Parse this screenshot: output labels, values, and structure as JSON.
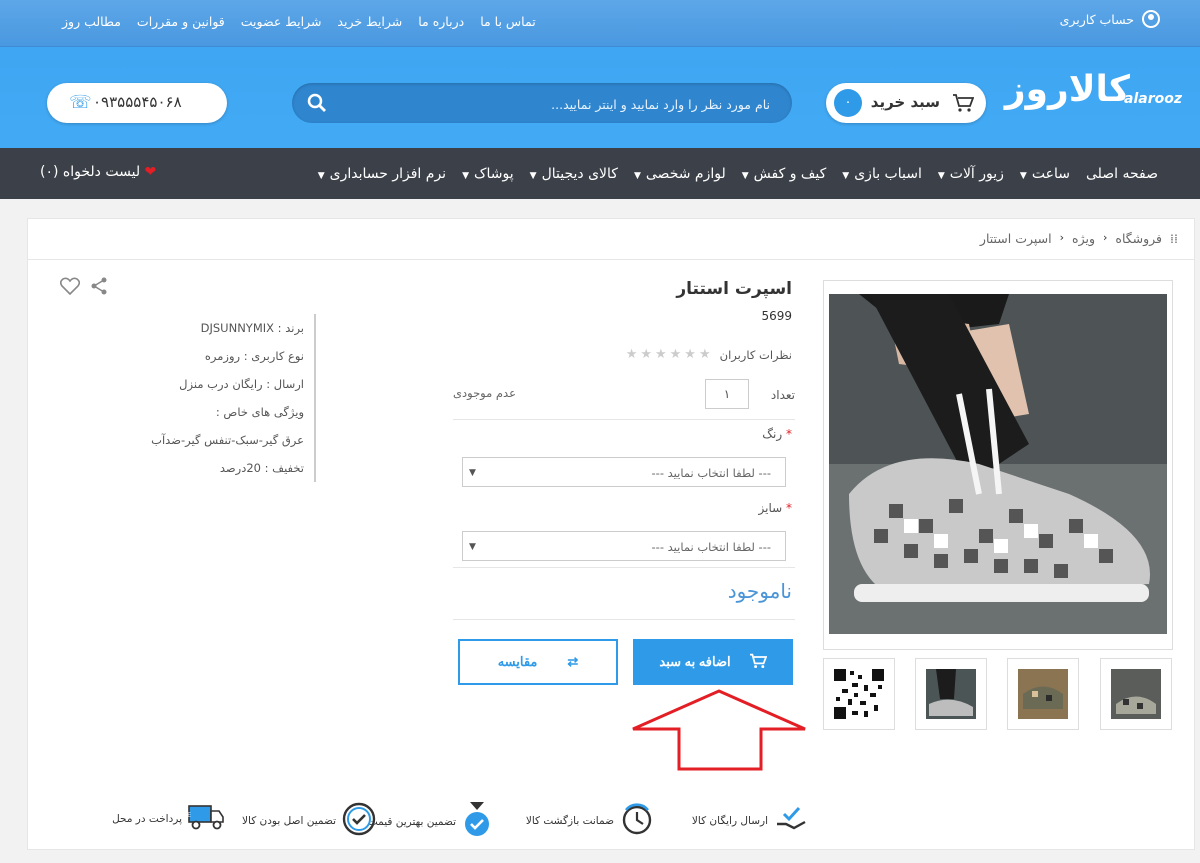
{
  "topbar": {
    "links": [
      "تماس با ما",
      "درباره ما",
      "شرایط خرید",
      "شرایط عضویت",
      "قوانین و مقررات",
      "مطالب روز"
    ],
    "account_label": "حساب کاربری"
  },
  "header": {
    "logo_mark": "کالاروز",
    "logo_latin": "alarooz",
    "cart_label": "سبد خرید",
    "cart_count": "۰",
    "search_placeholder": "نام مورد نظر را وارد نمایید و اینتر نمایید...",
    "phone": "۰۹۳۵۵۵۴۵۰۶۸"
  },
  "nav": {
    "items": [
      "صفحه اصلی",
      "ساعت",
      "زیور آلات",
      "اسباب بازی",
      "کیف و کفش",
      "لوازم شخصی",
      "کالای دیجیتال",
      "پوشاک",
      "نرم افزار حسابداری"
    ],
    "wishlist": "لیست دلخواه (۰)"
  },
  "breadcrumb": [
    "فروشگاه",
    "ویژه",
    "اسپرت استتار"
  ],
  "product": {
    "title": "اسپرت استتار",
    "code": "5699",
    "reviews_label": "نظرات کاربران",
    "qty_label": "تعداد",
    "qty_value": "۱",
    "stock_status": "عدم موجودی",
    "color_label": "رنگ",
    "size_label": "سایز",
    "select_placeholder": "--- لطفا انتخاب نمایید ---",
    "availability": "ناموجود",
    "add_to_cart": "اضافه به سبد",
    "compare": "مقایسه"
  },
  "specs": [
    "برند : DJSUNNYMIX",
    "نوع کاربری : روزمره",
    "ارسال : رایگان درب منزل",
    "ویژگی های خاص :",
    "عرق گیر-سبک-تنفس گیر-ضدآب",
    "تخفیف : 20درصد"
  ],
  "guarantees": [
    "ارسال رایگان کالا",
    "ضمانت بازگشت کالا",
    "تضمین بهترین قیمت",
    "تضمین اصل بودن کالا",
    "پرداخت در محل"
  ],
  "colors": {
    "primary": "#2f9be8",
    "nav_bg": "#3c4048",
    "header_bg": "#43aaf5",
    "arrow": "#e31e24"
  }
}
